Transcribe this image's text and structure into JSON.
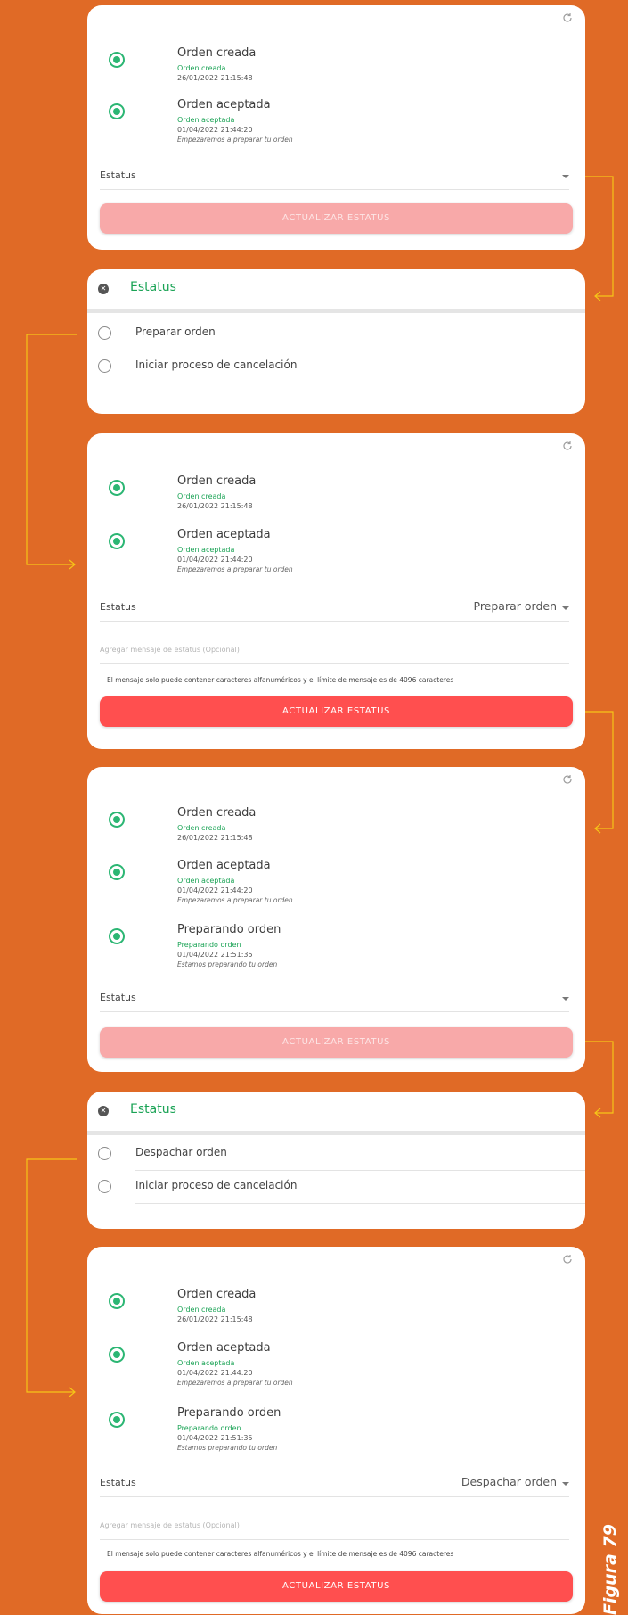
{
  "figure_label": "Figura 79",
  "colors": {
    "background": "#e06a26",
    "accent_green": "#1aa355",
    "button_active": "#ff4f4f",
    "button_disabled": "#f8a9a9",
    "connector": "#f5c518"
  },
  "icons": {
    "refresh": "refresh-icon",
    "close": "close-circle-icon",
    "checked": "radio-checked-icon",
    "unchecked": "radio-unchecked-icon"
  },
  "timeline_entries": {
    "creada": {
      "title": "Orden creada",
      "sub": "Orden creada",
      "date": "26/01/2022 21:15:48",
      "note": ""
    },
    "aceptada": {
      "title": "Orden aceptada",
      "sub": "Orden aceptada",
      "date": "01/04/2022 21:44:20",
      "note": "Empezaremos a preparar tu orden"
    },
    "preparando": {
      "title": "Preparando orden",
      "sub": "Preparando orden",
      "date": "01/04/2022 21:51:35",
      "note": "Estamos preparando tu orden"
    }
  },
  "status_label": "Estatus",
  "button_label": "ACTUALIZAR ESTATUS",
  "message_placeholder": "Agregar mensaje de estatus (Opcional)",
  "message_hint": "El mensaje solo puede contener caracteres alfanuméricos y el límite de mensaje es de 4096 caracteres",
  "card3": {
    "status_value": "Preparar orden"
  },
  "card6": {
    "status_value": "Despachar orden"
  },
  "dialog1": {
    "title": "Estatus",
    "options": [
      "Preparar orden",
      "Iniciar proceso de cancelación"
    ]
  },
  "dialog2": {
    "title": "Estatus",
    "options": [
      "Despachar orden",
      "Iniciar proceso de cancelación"
    ]
  }
}
